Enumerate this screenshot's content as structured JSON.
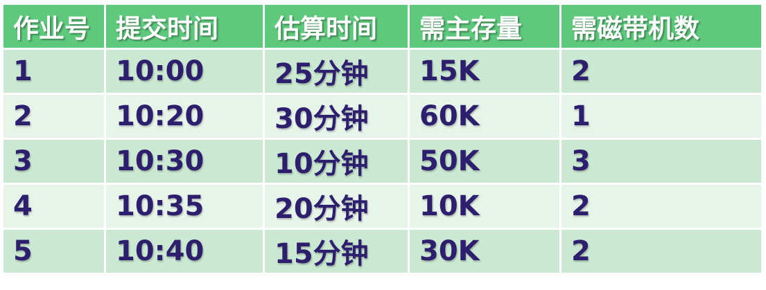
{
  "table": {
    "headers": [
      "作业号",
      "提交时间",
      "估算时间",
      "需主存量",
      "需磁带机数"
    ],
    "rows": [
      [
        "1",
        "10:00",
        "25分钟",
        "15K",
        "2"
      ],
      [
        "2",
        "10:20",
        "30分钟",
        "60K",
        "1"
      ],
      [
        "3",
        "10:30",
        "10分钟",
        "50K",
        "3"
      ],
      [
        "4",
        "10:35",
        "20分钟",
        "10K",
        "2"
      ],
      [
        "5",
        "10:40",
        "15分钟",
        "30K",
        "2"
      ]
    ]
  },
  "colors": {
    "header_bg": "#5ec97c",
    "header_text": "#ffffff",
    "row_odd_bg": "#cbe9d2",
    "row_even_bg": "#e7f4ea",
    "cell_text": "#2d1f6e"
  }
}
